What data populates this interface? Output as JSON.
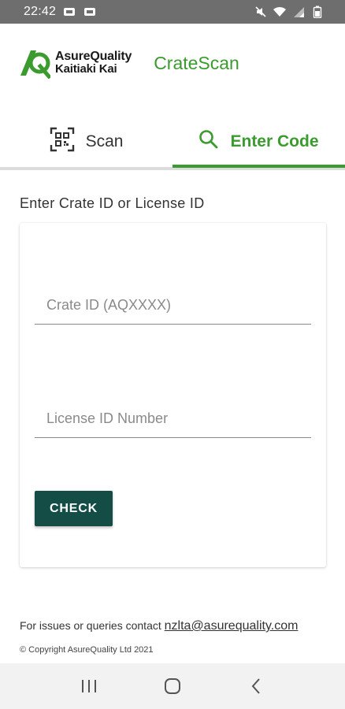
{
  "status_bar": {
    "time": "22:42",
    "icons": [
      "notification-icon",
      "notification-icon",
      "mute-icon",
      "wifi-icon",
      "signal-icon",
      "battery-icon"
    ]
  },
  "header": {
    "logo_line1": "AsureQuality",
    "logo_line2": "Kaitiaki Kai",
    "app_title": "CrateScan"
  },
  "tabs": [
    {
      "label": "Scan",
      "icon": "qr-scan-icon",
      "active": false
    },
    {
      "label": "Enter Code",
      "icon": "search-icon",
      "active": true
    }
  ],
  "form": {
    "heading": "Enter Crate ID or License ID",
    "crate_id_placeholder": "Crate ID (AQXXXX)",
    "crate_id_value": "",
    "license_id_placeholder": "License ID Number",
    "license_id_value": "",
    "check_label": "CHECK"
  },
  "footer": {
    "contact_text": "For issues or queries contact",
    "contact_email": "nzlta@asurequality.com",
    "copyright": "© Copyright AsureQuality Ltd 2021"
  },
  "nav_bar": {
    "icons": [
      "recent-apps-icon",
      "home-icon",
      "back-icon"
    ]
  },
  "colors": {
    "accent": "#3b9b2f",
    "button": "#144c46",
    "status_bar": "#6e6e6e"
  }
}
